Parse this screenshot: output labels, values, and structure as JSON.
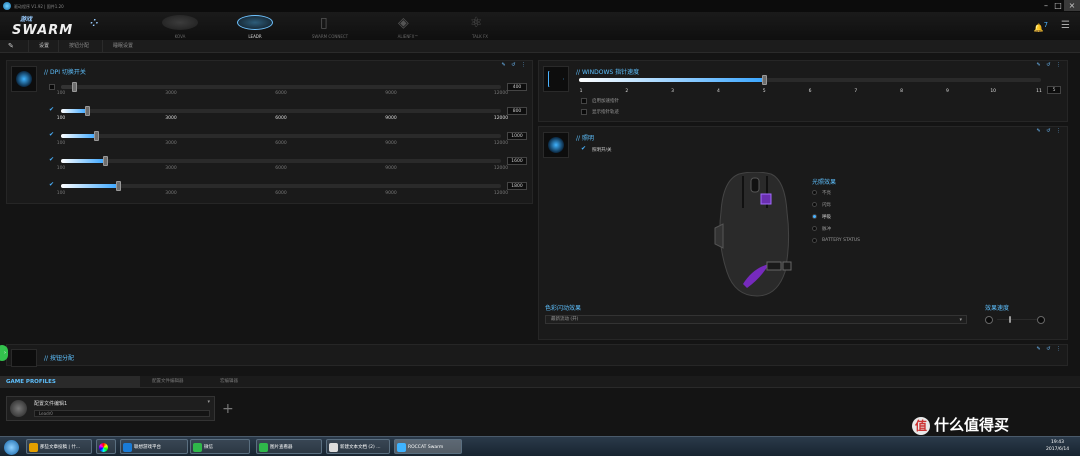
{
  "window": {
    "title": "驱动程序 V1.92 | 固件1.20"
  },
  "header": {
    "logo_small": "游戏",
    "logo_big": "SWARM",
    "devices": [
      {
        "label": "KOVA"
      },
      {
        "label": "LEADR"
      },
      {
        "label": "SWARM CONNECT"
      },
      {
        "label": "ALIENFX™"
      },
      {
        "label": "TALK FX"
      }
    ],
    "fx_glyph": "FX",
    "notif_count": "7"
  },
  "subnav": {
    "tabs": [
      "设置",
      "按钮分配",
      "睡眠设置"
    ]
  },
  "dpi": {
    "title": "// DPI 切换开关",
    "ticks": [
      "100",
      "3000",
      "6000",
      "9000",
      "12000"
    ],
    "rows": [
      {
        "value": "400",
        "fill": 0.03,
        "checked": false,
        "disabled": true
      },
      {
        "value": "800",
        "fill": 0.06,
        "checked": true
      },
      {
        "value": "1000",
        "fill": 0.08,
        "checked": true
      },
      {
        "value": "1600",
        "fill": 0.1,
        "checked": true
      },
      {
        "value": "1800",
        "fill": 0.13,
        "checked": true
      }
    ]
  },
  "pointer": {
    "title": "// WINDOWS 指针速度",
    "ticks": [
      "1",
      "2",
      "3",
      "4",
      "5",
      "6",
      "7",
      "8",
      "9",
      "10",
      "11"
    ],
    "value": "5",
    "fill": 0.4,
    "opt1": "启用加速指针",
    "opt2": "显示指针轨迹"
  },
  "light": {
    "title": "// 照明",
    "onoff": "照明开/关",
    "effects_title": "光照效果",
    "effects": [
      {
        "label": "不亮",
        "on": false
      },
      {
        "label": "闪烁",
        "on": false
      },
      {
        "label": "呼吸",
        "on": true
      },
      {
        "label": "脉冲",
        "on": false
      },
      {
        "label": "BATTERY STATUS",
        "on": false
      }
    ],
    "color_title": "色彩闪动效果",
    "color_value": "最新流动 (开)",
    "speed_title": "效果速度",
    "speed_value": 0.3
  },
  "buttons": {
    "title": "// 按钮分配"
  },
  "profiles": {
    "tab": "GAME PROFILES",
    "tab2": "配置文件编辑器",
    "tab3": "宏编辑器",
    "profile_name": "配置文件编辑1",
    "profile_sub": "Leadr0"
  },
  "taskbar": {
    "items": [
      "那些文章投稿 | 什...",
      "",
      "联想游戏平台",
      "微信",
      "图片查看器",
      "新建文本文档 (2) ...",
      "ROCCAT Swarm"
    ],
    "time": "19:43",
    "date": "2017/6/14"
  },
  "watermark": {
    "text": "什么值得买",
    "badge": "值"
  },
  "colors": {
    "accent": "#4ab3ff",
    "lighting": "#8a2be2"
  }
}
